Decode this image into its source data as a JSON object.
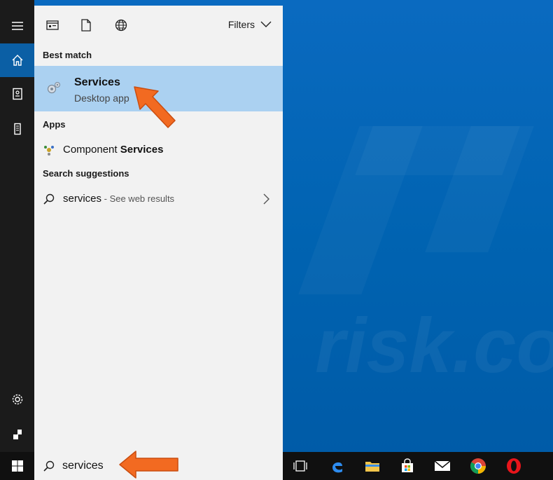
{
  "watermark": {
    "text": "risk.com"
  },
  "rail": {
    "items": [
      {
        "name": "hamburger-menu-icon"
      },
      {
        "name": "home-icon"
      },
      {
        "name": "notebook-icon"
      },
      {
        "name": "device-icon"
      },
      {
        "name": "settings-icon"
      },
      {
        "name": "feedback-icon"
      }
    ]
  },
  "toolbar": {
    "icons": [
      "apps-filter-icon",
      "documents-filter-icon",
      "web-filter-icon"
    ],
    "filters_label": "Filters"
  },
  "sections": {
    "best_match": "Best match",
    "apps": "Apps",
    "suggestions": "Search suggestions"
  },
  "best_match": {
    "title": "Services",
    "subtitle": "Desktop app"
  },
  "apps": [
    {
      "label_plain": "Component ",
      "label_bold": "Services"
    }
  ],
  "suggestions": [
    {
      "term": "services",
      "hint": " - See web results"
    }
  ],
  "search": {
    "value": "services",
    "placeholder": ""
  },
  "taskbar": {
    "apps": [
      "task-view-icon",
      "edge-icon",
      "file-explorer-icon",
      "store-icon",
      "mail-icon",
      "chrome-icon",
      "opera-icon"
    ]
  },
  "colors": {
    "accent": "#0b5fa5",
    "highlight": "#abd1f1",
    "desktop": "#0063b1",
    "arrow": "#f26a21"
  }
}
